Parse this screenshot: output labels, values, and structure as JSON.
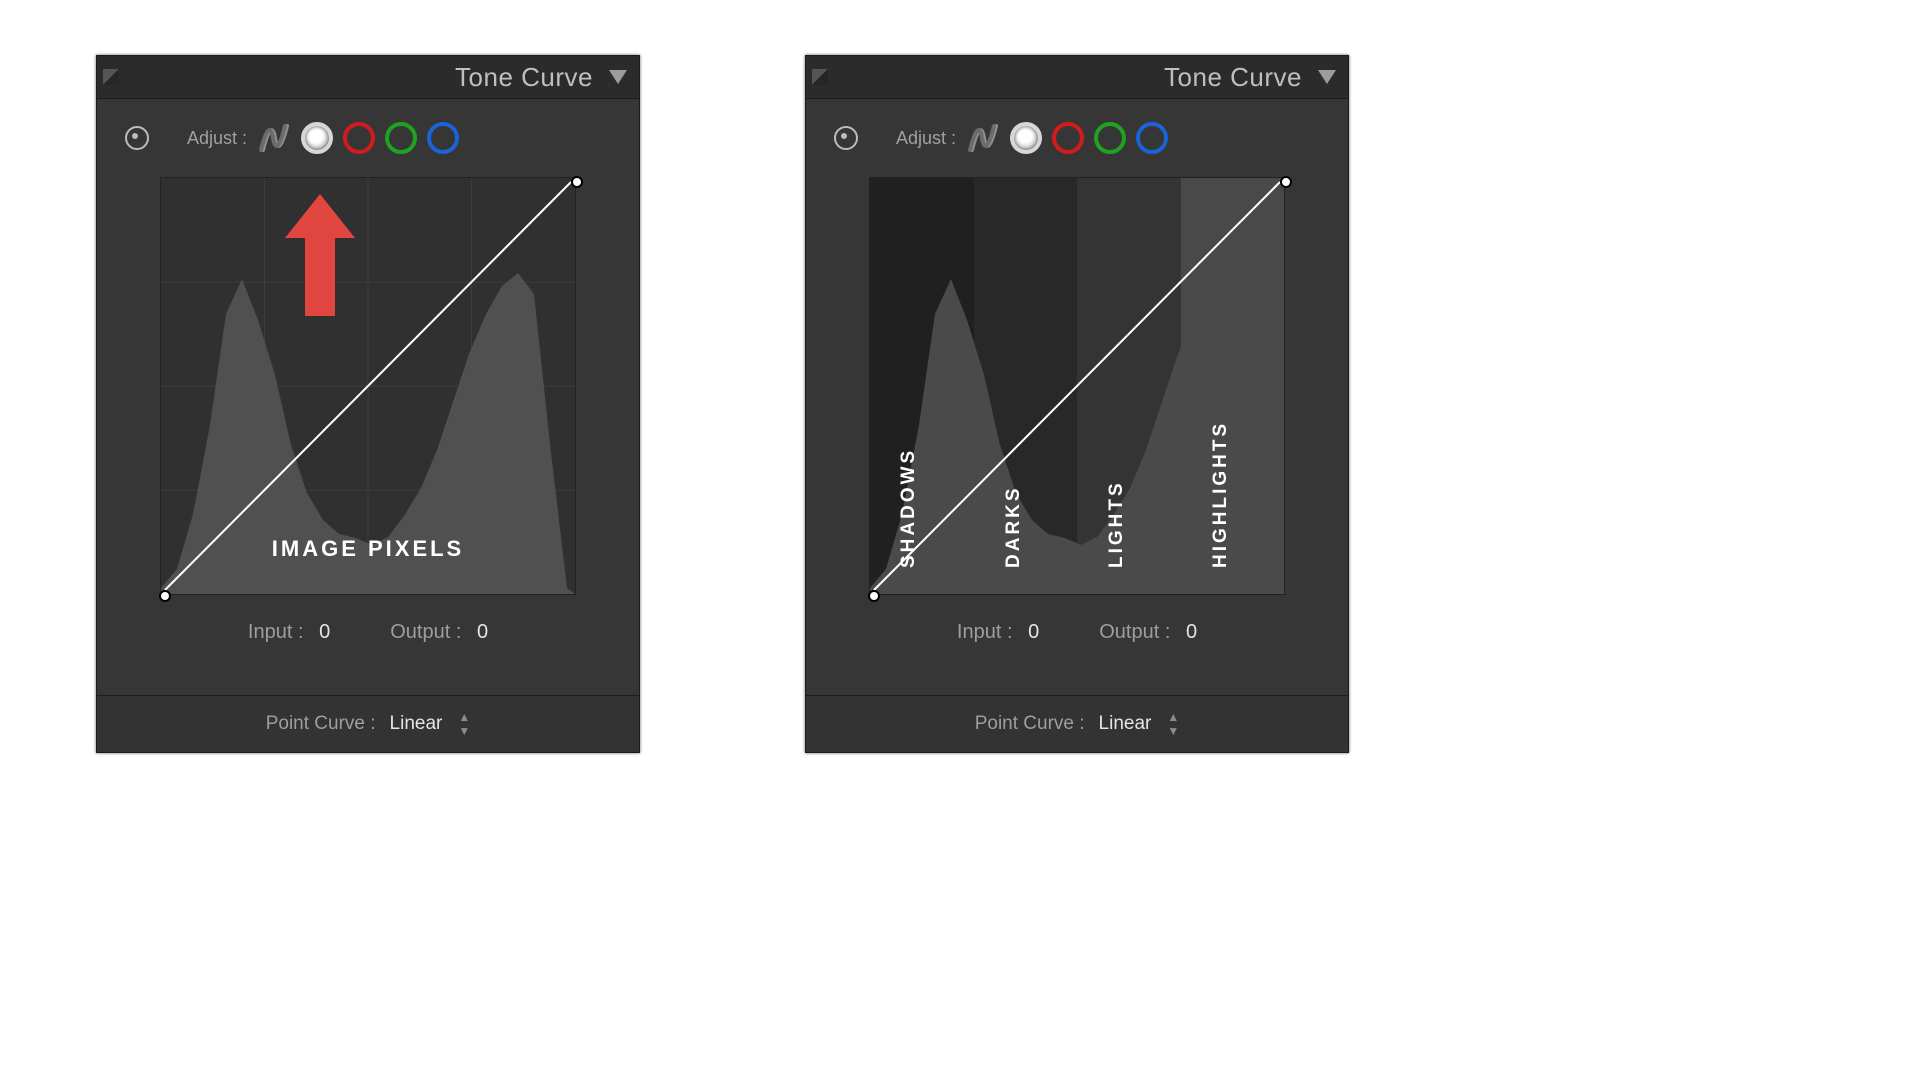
{
  "title": "Tone Curve",
  "adjust_label": "Adjust :",
  "io": {
    "input_label": "Input :",
    "input_value": "0",
    "output_label": "Output :",
    "output_value": "0"
  },
  "point_curve": {
    "label": "Point Curve :",
    "value": "Linear"
  },
  "left_panel": {
    "caption": "IMAGE PIXELS"
  },
  "right_panel": {
    "zones": [
      "SHADOWS",
      "DARKS",
      "LIGHTS",
      "HIGHLIGHTS"
    ]
  },
  "channels": [
    "parametric",
    "white",
    "red",
    "green",
    "blue"
  ],
  "chart_data": {
    "type": "line",
    "title": "Tone Curve (Point Curve)",
    "xlabel": "Input",
    "ylabel": "Output",
    "xlim": [
      0,
      255
    ],
    "ylim": [
      0,
      255
    ],
    "series": [
      {
        "name": "curve",
        "x": [
          0,
          255
        ],
        "y": [
          0,
          255
        ]
      }
    ],
    "histogram_outline_x": [
      0,
      10,
      20,
      30,
      40,
      50,
      60,
      70,
      80,
      90,
      100,
      110,
      120,
      130,
      140,
      150,
      160,
      170,
      180,
      190,
      200,
      210,
      220,
      230,
      240,
      255
    ],
    "histogram_outline_y": [
      0,
      15,
      55,
      120,
      205,
      230,
      200,
      160,
      110,
      75,
      55,
      45,
      38,
      35,
      42,
      58,
      78,
      105,
      140,
      175,
      205,
      225,
      235,
      220,
      110,
      0
    ],
    "zones": [
      {
        "name": "Shadows",
        "range": [
          0,
          63
        ]
      },
      {
        "name": "Darks",
        "range": [
          64,
          127
        ]
      },
      {
        "name": "Lights",
        "range": [
          128,
          191
        ]
      },
      {
        "name": "Highlights",
        "range": [
          192,
          255
        ]
      }
    ]
  }
}
